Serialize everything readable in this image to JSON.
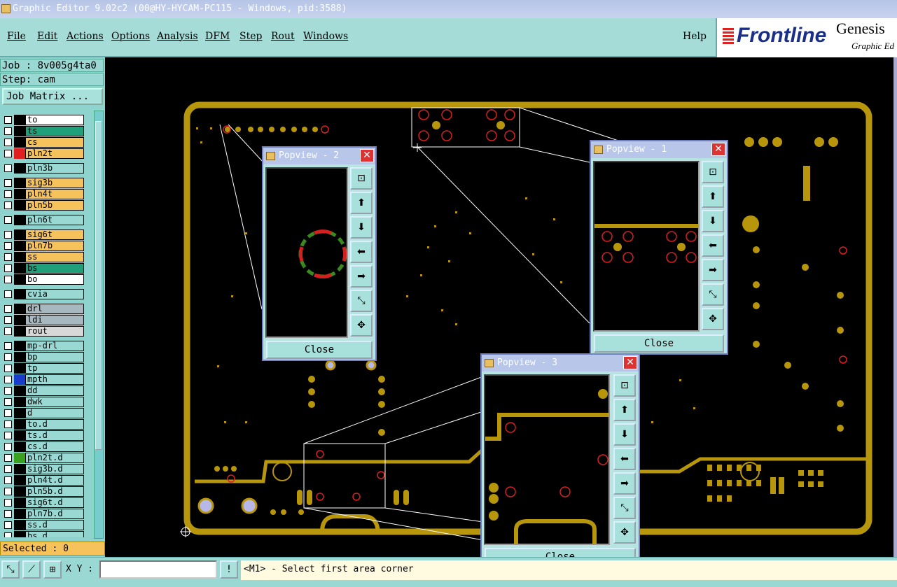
{
  "window": {
    "title": "Graphic Editor 9.02c2 (00@HY-HYCAM-PC115 - Windows, pid:3588)"
  },
  "menu": {
    "items": [
      "File",
      "Edit",
      "Actions",
      "Options",
      "Analysis",
      "DFM",
      "Step",
      "Rout",
      "Windows"
    ],
    "help": "Help"
  },
  "logo": {
    "brand": "Frontline",
    "product": "Genesis",
    "subtitle": "Graphic Ed"
  },
  "job": {
    "job_label": "Job : 8v005g4ta0",
    "step_label": "Step: cam",
    "matrix_button": "Job Matrix ..."
  },
  "layers": [
    {
      "name": "to",
      "color": "#ffffff",
      "mark": "#000000"
    },
    {
      "name": "ts",
      "color": "#1fa07a",
      "mark": "#000000"
    },
    {
      "name": "cs",
      "color": "#f5c25c",
      "mark": "#000000"
    },
    {
      "name": "pln2t",
      "color": "#f5c25c",
      "mark": "#e02020"
    },
    {
      "name": "pln3b",
      "color": "#9ad8d4",
      "mark": "#000000"
    },
    {
      "name": "sig3b",
      "color": "#f5c25c",
      "mark": "#000000"
    },
    {
      "name": "pln4t",
      "color": "#f5c25c",
      "mark": "#000000"
    },
    {
      "name": "pln5b",
      "color": "#f5c25c",
      "mark": "#000000"
    },
    {
      "name": "pln6t",
      "color": "#9ad8d4",
      "mark": "#000000"
    },
    {
      "name": "sig6t",
      "color": "#f5c25c",
      "mark": "#000000"
    },
    {
      "name": "pln7b",
      "color": "#f5c25c",
      "mark": "#000000"
    },
    {
      "name": "ss",
      "color": "#f5c25c",
      "mark": "#000000"
    },
    {
      "name": "bs",
      "color": "#1fa07a",
      "mark": "#000000"
    },
    {
      "name": "bo",
      "color": "#ffffff",
      "mark": "#000000"
    },
    {
      "name": "cvia",
      "color": "#9ad8d4",
      "mark": "#000000"
    },
    {
      "name": "drl",
      "color": "#a8b8c0",
      "mark": "#000000"
    },
    {
      "name": "ldi",
      "color": "#a8b8c0",
      "mark": "#000000"
    },
    {
      "name": "rout",
      "color": "#d8d8d8",
      "mark": "#000000"
    },
    {
      "name": "mp-drl",
      "color": "#9ad8d4",
      "mark": "#000000"
    },
    {
      "name": "bp",
      "color": "#9ad8d4",
      "mark": "#000000"
    },
    {
      "name": "tp",
      "color": "#9ad8d4",
      "mark": "#000000"
    },
    {
      "name": "mpth",
      "color": "#9ad8d4",
      "mark": "#1a3ccc"
    },
    {
      "name": "dd",
      "color": "#9ad8d4",
      "mark": "#000000"
    },
    {
      "name": "dwk",
      "color": "#9ad8d4",
      "mark": "#000000"
    },
    {
      "name": "d",
      "color": "#9ad8d4",
      "mark": "#000000"
    },
    {
      "name": "to.d",
      "color": "#9ad8d4",
      "mark": "#000000"
    },
    {
      "name": "ts.d",
      "color": "#9ad8d4",
      "mark": "#000000"
    },
    {
      "name": "cs.d",
      "color": "#9ad8d4",
      "mark": "#000000"
    },
    {
      "name": "pln2t.d",
      "color": "#9ad8d4",
      "mark": "#3aa020"
    },
    {
      "name": "sig3b.d",
      "color": "#9ad8d4",
      "mark": "#000000"
    },
    {
      "name": "pln4t.d",
      "color": "#9ad8d4",
      "mark": "#000000"
    },
    {
      "name": "pln5b.d",
      "color": "#9ad8d4",
      "mark": "#000000"
    },
    {
      "name": "sig6t.d",
      "color": "#9ad8d4",
      "mark": "#000000"
    },
    {
      "name": "pln7b.d",
      "color": "#9ad8d4",
      "mark": "#000000"
    },
    {
      "name": "ss.d",
      "color": "#9ad8d4",
      "mark": "#000000"
    },
    {
      "name": "bs.d",
      "color": "#9ad8d4",
      "mark": "#000000"
    }
  ],
  "selected": "Selected : 0",
  "status": {
    "xy_label": "X Y :",
    "warn": "!",
    "message": "<M1> - Select first area corner"
  },
  "popviews": [
    {
      "title": "Popview - 2",
      "close": "Close"
    },
    {
      "title": "Popview - 1",
      "close": "Close"
    },
    {
      "title": "Popview - 3",
      "close": "Close"
    }
  ],
  "colors": {
    "copper": "#b8960c",
    "pad_red": "#d62020",
    "canvas": "#000000"
  }
}
